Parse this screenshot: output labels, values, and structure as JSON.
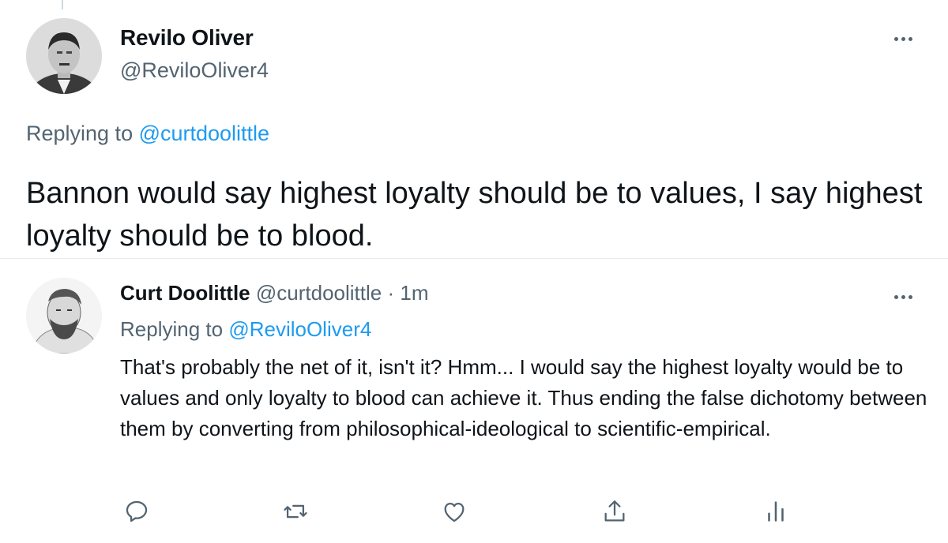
{
  "main_tweet": {
    "author_name": "Revilo Oliver",
    "author_handle": "@ReviloOliver4",
    "replying_prefix": "Replying to ",
    "replying_to": "@curtdoolittle",
    "text": "Bannon would say highest loyalty should be to values, I say highest loyalty should be to blood."
  },
  "reply_tweet": {
    "author_name": "Curt Doolittle",
    "author_handle": "@curtdoolittle",
    "separator": "·",
    "time": "1m",
    "replying_prefix": "Replying to ",
    "replying_to": "@ReviloOliver4",
    "text": "That's probably the net of it, isn't it? Hmm... I would say the highest loyalty would be to values and only loyalty to blood can achieve it. Thus ending the false dichotomy between them by converting from philosophical-ideological to scientific-empirical."
  },
  "actions": [
    {
      "icon": "reply-icon"
    },
    {
      "icon": "retweet-icon"
    },
    {
      "icon": "like-icon"
    },
    {
      "icon": "share-icon"
    },
    {
      "icon": "analytics-icon"
    }
  ],
  "colors": {
    "text": "#0f1419",
    "secondary": "#536471",
    "link": "#1d9bf0",
    "divider": "#e6ecf0"
  }
}
